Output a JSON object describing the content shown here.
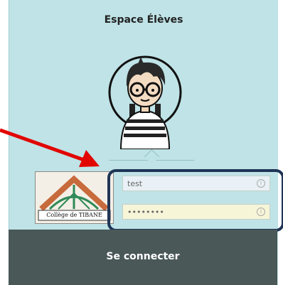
{
  "header": {
    "title": "Espace Élèves"
  },
  "avatar": {
    "icon": "student-avatar-icon"
  },
  "logo": {
    "text": "Collège de TIBANE"
  },
  "form": {
    "login_value": "test",
    "password_value": "••••••••",
    "info_glyph": "i"
  },
  "footer": {
    "connect_label": "Se connecter"
  },
  "colors": {
    "panel_bg": "#bfe3e6",
    "bottom_bar": "#4a5858",
    "highlight_border": "#1f3556",
    "arrow": "#e10600"
  }
}
